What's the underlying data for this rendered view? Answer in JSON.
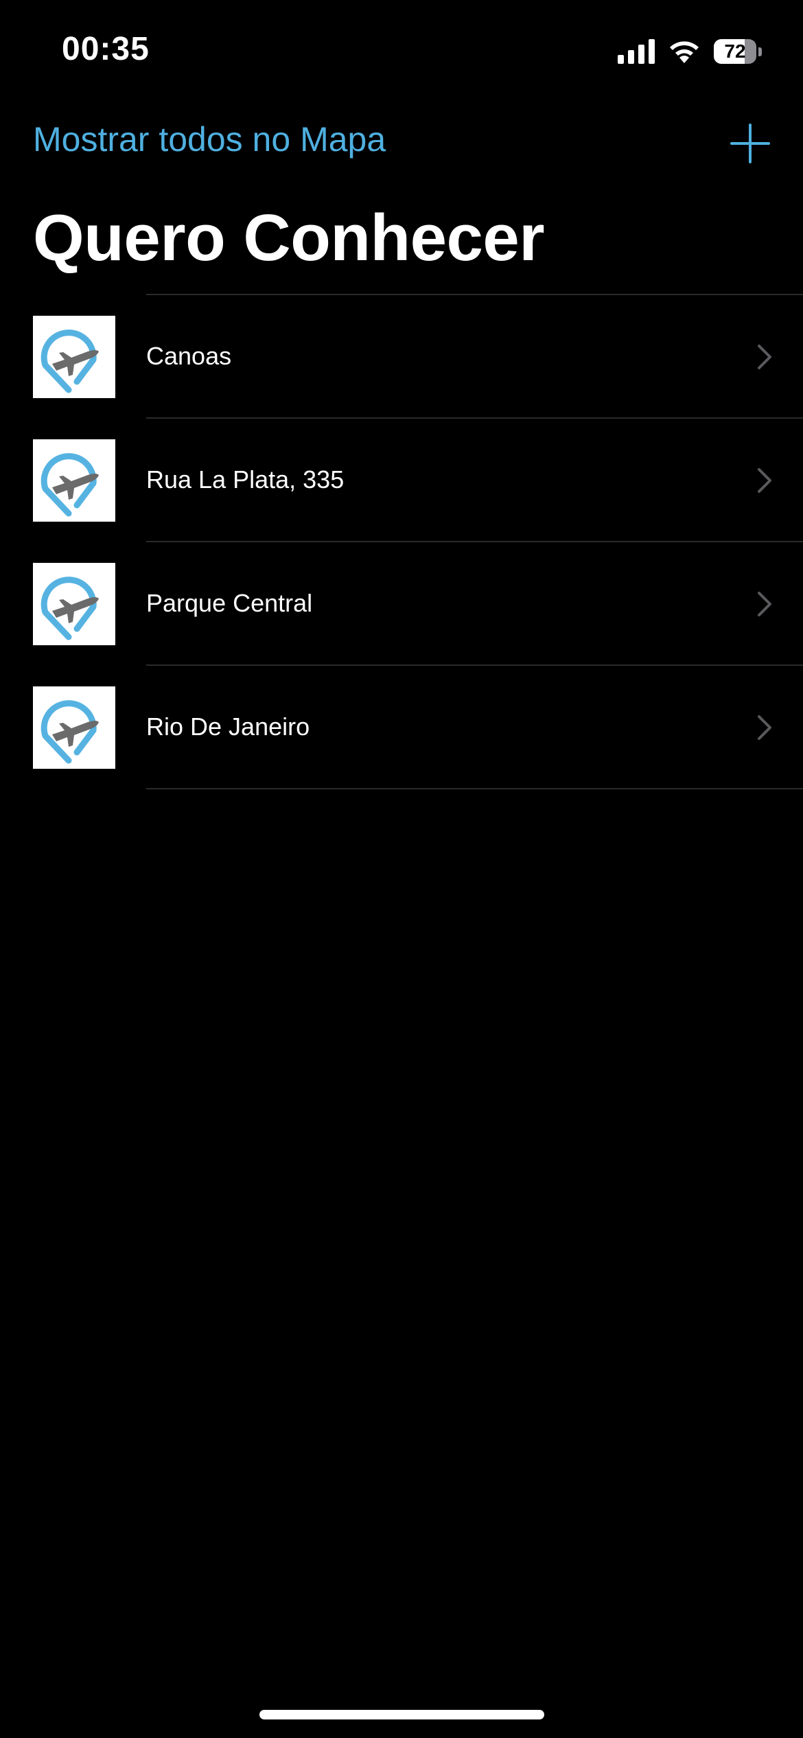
{
  "status_bar": {
    "time": "00:35",
    "battery_percent": 72,
    "battery_label": "72",
    "signal_icon": "cellular-signal-icon",
    "wifi_icon": "wifi-icon"
  },
  "nav": {
    "show_all_label": "Mostrar todos no Mapa",
    "add_icon": "plus-icon"
  },
  "title": "Quero Conhecer",
  "places": [
    {
      "name": "Canoas",
      "icon": "airplane-location-pin-icon"
    },
    {
      "name": "Rua La Plata, 335",
      "icon": "airplane-location-pin-icon"
    },
    {
      "name": "Parque Central",
      "icon": "airplane-location-pin-icon"
    },
    {
      "name": "Rio De Janeiro",
      "icon": "airplane-location-pin-icon"
    }
  ],
  "colors": {
    "accent": "#4fb0e0",
    "background": "#000000",
    "text": "#ffffff",
    "separator": "#2a2a2c",
    "chevron": "#5a5a5e",
    "pin": "#56b3e1",
    "plane": "#6b6b6b"
  }
}
